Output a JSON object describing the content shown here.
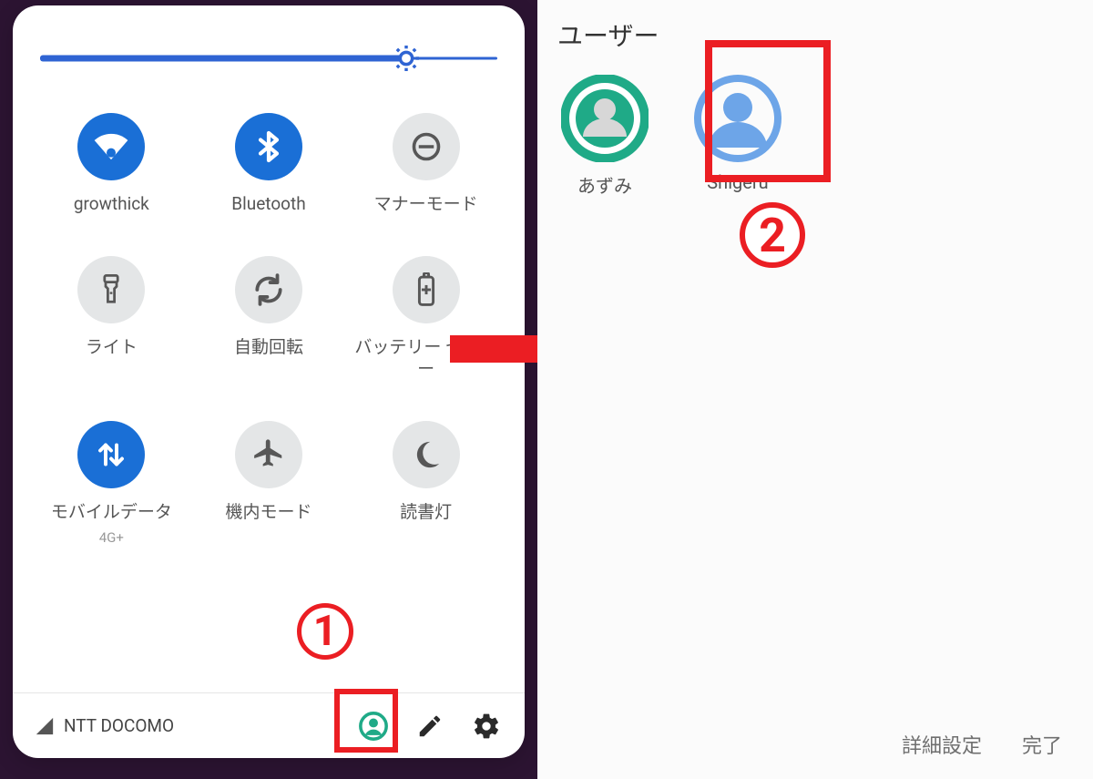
{
  "quickSettings": {
    "brightness_percent": 80,
    "tiles": [
      {
        "label": "growthick",
        "sublabel": "",
        "icon": "wifi"
      },
      {
        "label": "Bluetooth",
        "sublabel": "",
        "icon": "bluetooth"
      },
      {
        "label": "マナーモード",
        "sublabel": "",
        "icon": "dnd"
      },
      {
        "label": "ライト",
        "sublabel": "",
        "icon": "flashlight"
      },
      {
        "label": "自動回転",
        "sublabel": "",
        "icon": "rotate"
      },
      {
        "label": "バッテリー セーバー",
        "sublabel": "",
        "icon": "battery"
      },
      {
        "label": "モバイルデータ",
        "sublabel": "4G+",
        "icon": "mobiledata"
      },
      {
        "label": "機内モード",
        "sublabel": "",
        "icon": "airplane"
      },
      {
        "label": "読書灯",
        "sublabel": "",
        "icon": "night"
      }
    ],
    "footer": {
      "carrier": "NTT DOCOMO"
    }
  },
  "annotations": {
    "step1": "1",
    "step2": "2"
  },
  "usersPanel": {
    "title": "ユーザー",
    "users": [
      {
        "name": "あずみ",
        "selected": true,
        "color": "#1faa87"
      },
      {
        "name": "Shigeru",
        "selected": false,
        "color": "#6da5e8"
      }
    ],
    "actions": {
      "details": "詳細設定",
      "done": "完了"
    }
  }
}
